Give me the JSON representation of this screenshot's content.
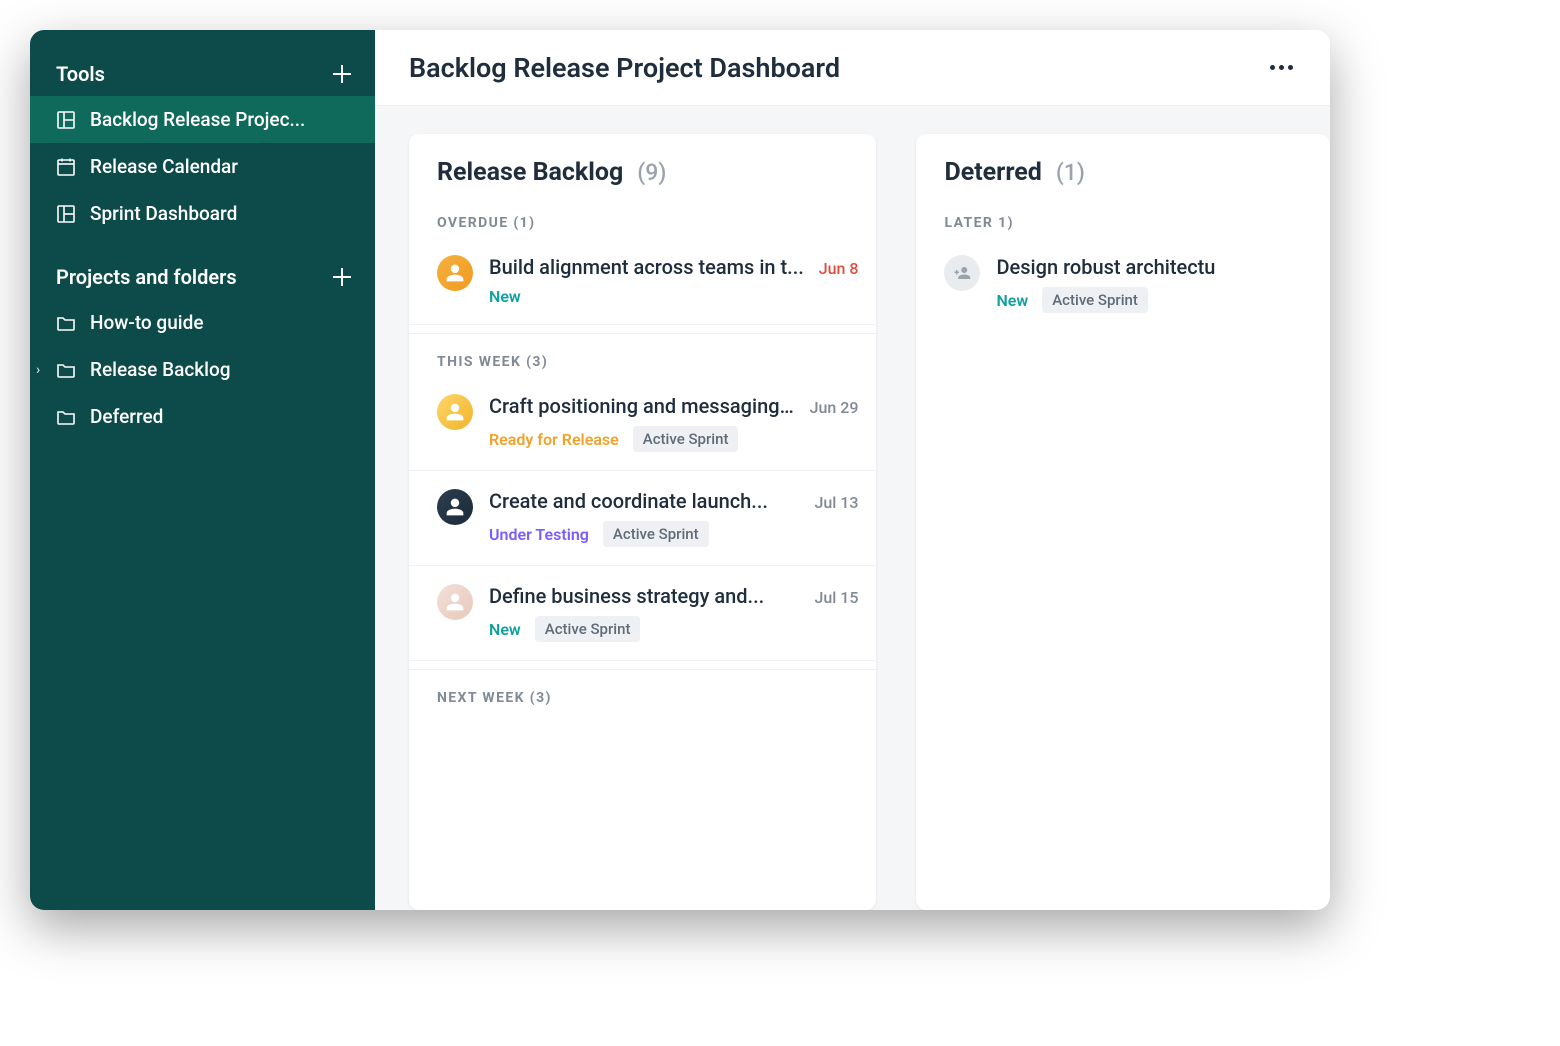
{
  "header": {
    "title": "Backlog Release Project Dashboard"
  },
  "sidebar": {
    "tools_header": "Tools",
    "tools": [
      {
        "label": "Backlog Release Projec...",
        "icon": "layout",
        "selected": true
      },
      {
        "label": "Release Calendar",
        "icon": "calendar",
        "selected": false
      },
      {
        "label": "Sprint Dashboard",
        "icon": "layout",
        "selected": false
      }
    ],
    "projects_header": "Projects and folders",
    "projects": [
      {
        "label": "How-to guide",
        "icon": "folder",
        "chevron": false
      },
      {
        "label": "Release Backlog",
        "icon": "folder",
        "chevron": true
      },
      {
        "label": "Deferred",
        "icon": "folder",
        "chevron": false
      }
    ]
  },
  "columns": [
    {
      "title": "Release Backlog",
      "count": "(9)",
      "groups": [
        {
          "label": "OVERDUE (1)",
          "cards": [
            {
              "title": "Build alignment across teams in t...",
              "date": "Jun 8",
              "date_style": "red",
              "status": "New",
              "status_style": "new",
              "tags": [],
              "avatar": "a1"
            }
          ]
        },
        {
          "label": "THIS WEEK (3)",
          "cards": [
            {
              "title": "Craft positioning and messaging...",
              "date": "Jun 29",
              "date_style": "grey",
              "status": "Ready for Release",
              "status_style": "ready",
              "tags": [
                "Active Sprint"
              ],
              "avatar": "a2"
            },
            {
              "title": "Create and coordinate launch...",
              "date": "Jul 13",
              "date_style": "grey",
              "status": "Under Testing",
              "status_style": "testing",
              "tags": [
                "Active Sprint"
              ],
              "avatar": "a3"
            },
            {
              "title": "Define business strategy and...",
              "date": "Jul 15",
              "date_style": "grey",
              "status": "New",
              "status_style": "new",
              "tags": [
                "Active Sprint"
              ],
              "avatar": "a4"
            }
          ]
        },
        {
          "label": "NEXT WEEK (3)",
          "cards": []
        }
      ]
    },
    {
      "title": "Deterred",
      "count": "(1)",
      "groups": [
        {
          "label": "LATER 1)",
          "cards": [
            {
              "title": "Design robust architectu",
              "date": "",
              "date_style": "grey",
              "status": "New",
              "status_style": "new",
              "tags": [
                "Active Sprint"
              ],
              "avatar": "unassigned"
            }
          ]
        }
      ]
    }
  ]
}
